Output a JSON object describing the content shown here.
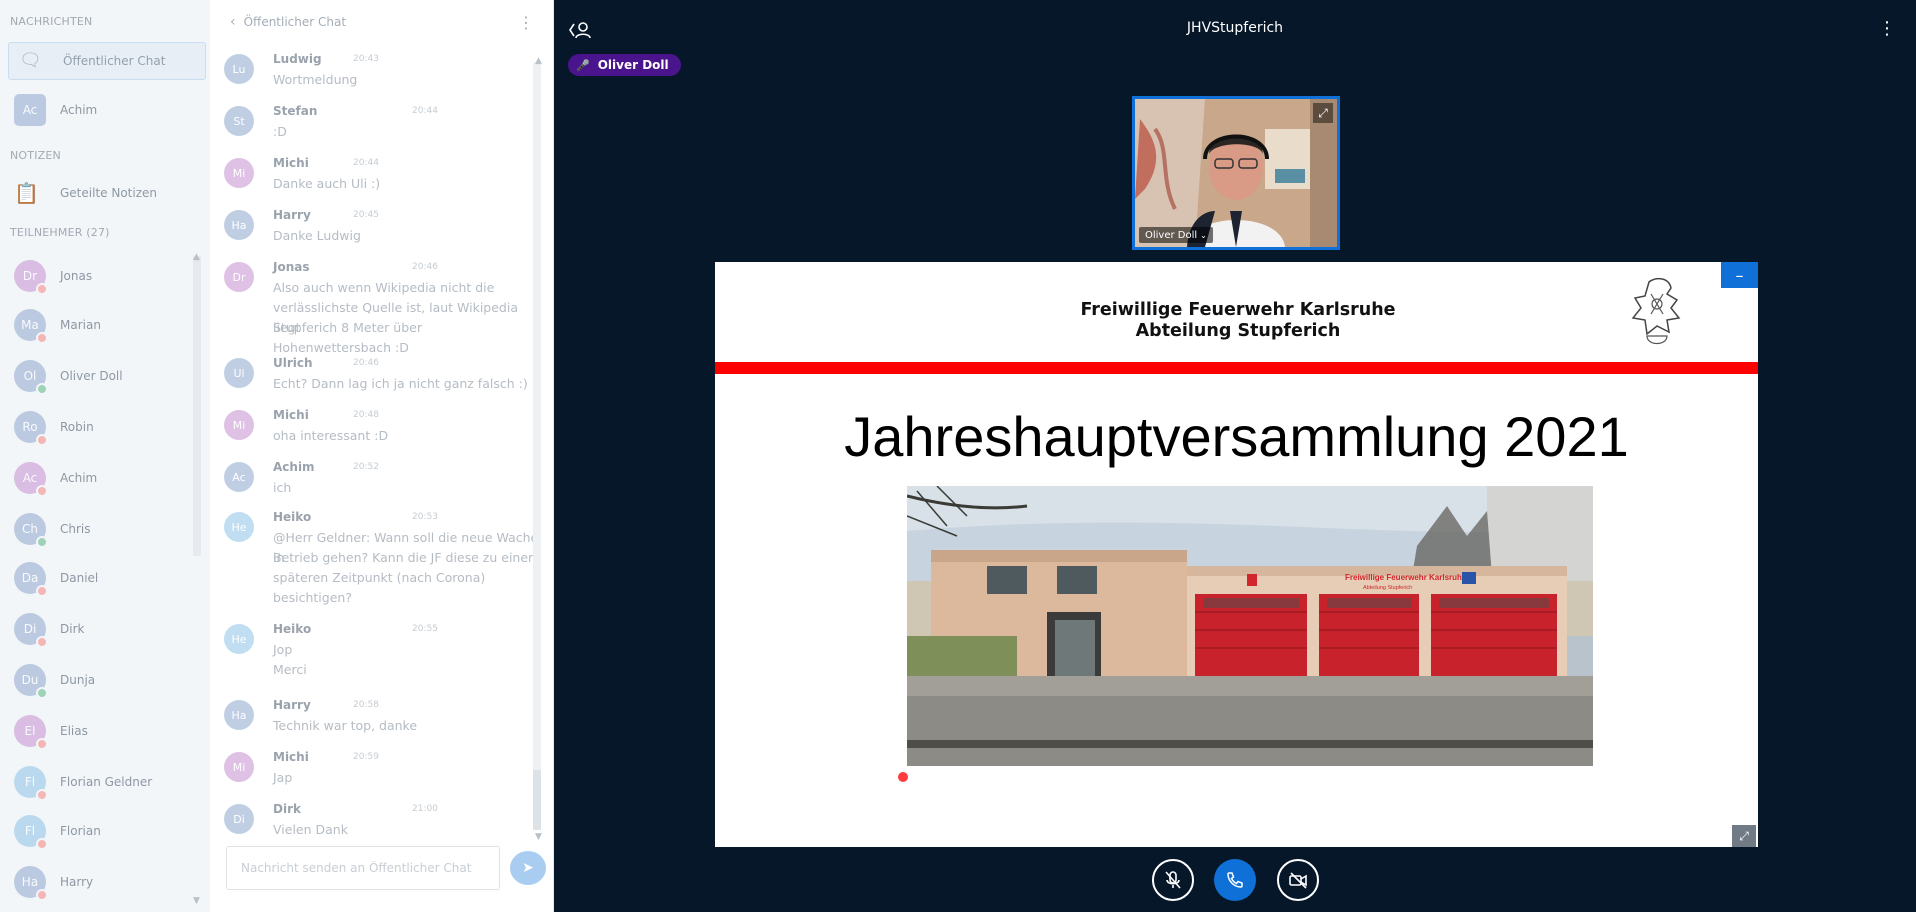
{
  "users_panel": {
    "messages_heading": "NACHRICHTEN",
    "public_chat_label": "Öffentlicher Chat",
    "private_chat": {
      "initials": "Ac",
      "name": "Achim",
      "color": "#8ea7cf"
    },
    "notes_heading": "NOTIZEN",
    "shared_notes_label": "Geteilte Notizen",
    "participants_heading": "TEILNEHMER (27)",
    "participants": [
      {
        "initials": "Dr",
        "name": "Jonas",
        "color": "#c58fd0",
        "status": "red"
      },
      {
        "initials": "Ma",
        "name": "Marian",
        "color": "#8ea7cf",
        "status": "red"
      },
      {
        "initials": "Ol",
        "name": "Oliver Doll",
        "color": "#8ea7cf",
        "status": "green"
      },
      {
        "initials": "Ro",
        "name": "Robin",
        "color": "#8ea7cf",
        "status": "red"
      },
      {
        "initials": "Ac",
        "name": "Achim",
        "color": "#c58fd0",
        "status": "red"
      },
      {
        "initials": "Ch",
        "name": "Chris",
        "color": "#8ea7cf",
        "status": "green"
      },
      {
        "initials": "Da",
        "name": "Daniel",
        "color": "#8ea7cf",
        "status": "red"
      },
      {
        "initials": "Di",
        "name": "Dirk",
        "color": "#8ea7cf",
        "status": "red"
      },
      {
        "initials": "Du",
        "name": "Dunja",
        "color": "#8ea7cf",
        "status": "green"
      },
      {
        "initials": "El",
        "name": "Elias",
        "color": "#c58fd0",
        "status": "red"
      },
      {
        "initials": "Fl",
        "name": "Florian Geldner",
        "color": "#8ec3e6",
        "status": "red"
      },
      {
        "initials": "Fl",
        "name": "Florian",
        "color": "#8ec3e6",
        "status": "red"
      },
      {
        "initials": "Ha",
        "name": "Harry",
        "color": "#8ea7cf",
        "status": "red"
      }
    ]
  },
  "chat": {
    "header_title": "Öffentlicher Chat",
    "input_placeholder": "Nachricht senden an Öffentlicher Chat",
    "messages": [
      {
        "initials": "Lu",
        "name": "Ludwig",
        "time": "20:43",
        "lines": [
          "Wortmeldung"
        ],
        "color": "#8ea7cf"
      },
      {
        "initials": "St",
        "name": "Stefan",
        "time": "20:44",
        "lines": [
          ":D"
        ],
        "color": "#8ea7cf"
      },
      {
        "initials": "Mi",
        "name": "Michi",
        "time": "20:44",
        "lines": [
          "Danke auch Uli :)"
        ],
        "color": "#c58fd0"
      },
      {
        "initials": "Ha",
        "name": "Harry",
        "time": "20:45",
        "lines": [
          "Danke Ludwig"
        ],
        "color": "#8ea7cf"
      },
      {
        "initials": "Dr",
        "name": "Jonas",
        "time": "20:46",
        "lines": [
          "Also auch wenn Wikipedia nicht die",
          "verlässlichste Quelle ist, laut Wikipedia liegt",
          "Stupferich 8 Meter über Hohenwettersbach :D"
        ],
        "color": "#c58fd0"
      },
      {
        "initials": "Ul",
        "name": "Ulrich",
        "time": "20:46",
        "lines": [
          "Echt? Dann lag ich ja nicht ganz falsch :)"
        ],
        "color": "#8ea7cf"
      },
      {
        "initials": "Mi",
        "name": "Michi",
        "time": "20:48",
        "lines": [
          "oha interessant :D"
        ],
        "color": "#c58fd0"
      },
      {
        "initials": "Ac",
        "name": "Achim",
        "time": "20:52",
        "lines": [
          "ich"
        ],
        "color": "#8ea7cf"
      },
      {
        "initials": "He",
        "name": "Heiko",
        "time": "20:53",
        "lines": [
          "@Herr Geldner: Wann soll die neue Wache in",
          "Betrieb gehen? Kann die JF diese zu einem",
          "späteren Zeitpunkt (nach Corona)",
          "besichtigen?"
        ],
        "color": "#8ec3e6"
      },
      {
        "initials": "He",
        "name": "Heiko",
        "time": "20:55",
        "lines": [
          "Jop",
          "Merci"
        ],
        "color": "#8ec3e6"
      },
      {
        "initials": "Ha",
        "name": "Harry",
        "time": "20:58",
        "lines": [
          "Technik war top, danke"
        ],
        "color": "#8ea7cf"
      },
      {
        "initials": "Mi",
        "name": "Michi",
        "time": "20:59",
        "lines": [
          "Jap"
        ],
        "color": "#c58fd0"
      },
      {
        "initials": "Di",
        "name": "Dirk",
        "time": "21:00",
        "lines": [
          "Vielen Dank"
        ],
        "color": "#8ea7cf"
      }
    ]
  },
  "main": {
    "meeting_title": "JHVStupferich",
    "talking_indicator": "Oliver Doll",
    "webcam_name": "Oliver Doll",
    "slide": {
      "header_line1": "Freiwillige Feuerwehr Karlsruhe",
      "header_line2": "Abteilung Stupferich",
      "title": "Jahreshauptversammlung 2021",
      "photo_sign_line1": "Freiwillige Feuerwehr Karlsruhe",
      "photo_sign_line2": "Abteilung Stupferich"
    },
    "minimize_glyph": "–",
    "accent_color": "#0f70d7",
    "background_color": "#06172a"
  },
  "icons": {
    "user_list": "person-icon",
    "options": "kebab-icon",
    "mute": "microphone-muted-icon",
    "leave_audio": "phone-icon",
    "webcam": "video-off-icon"
  }
}
